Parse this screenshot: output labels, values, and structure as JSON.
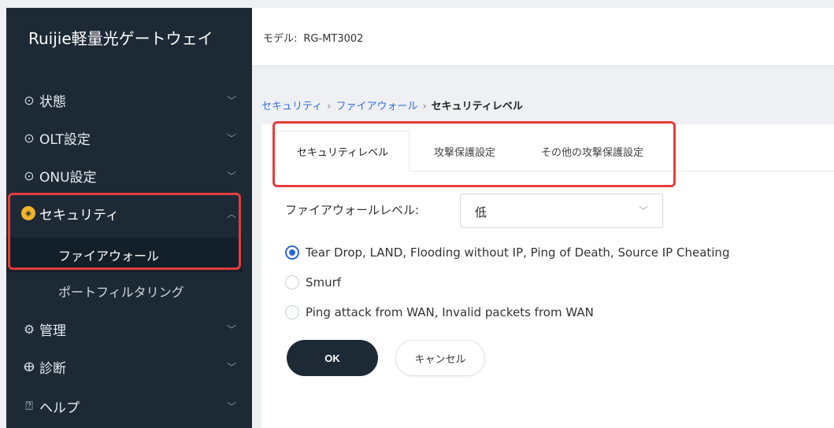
{
  "brand": "Ruijie軽量光ゲートウェイ",
  "model": {
    "label": "モデル:",
    "value": "RG-MT3002"
  },
  "sidebar": {
    "items": [
      {
        "label": "状態",
        "icon": "status-icon"
      },
      {
        "label": "OLT設定",
        "icon": "olt-icon"
      },
      {
        "label": "ONU設定",
        "icon": "onu-icon"
      },
      {
        "label": "セキュリティ",
        "icon": "shield-icon"
      },
      {
        "label": "管理",
        "icon": "gear-icon"
      },
      {
        "label": "診断",
        "icon": "stethoscope-icon"
      },
      {
        "label": "ヘルプ",
        "icon": "help-icon"
      }
    ],
    "sub_items": [
      {
        "label": "ファイアウォール"
      },
      {
        "label": "ポートフィルタリング"
      }
    ]
  },
  "breadcrumb": {
    "items": [
      "セキュリティ",
      "ファイアウォール"
    ],
    "current": "セキュリティレベル",
    "separator": "›"
  },
  "tabs": [
    {
      "label": "セキュリティレベル"
    },
    {
      "label": "攻撃保護設定"
    },
    {
      "label": "その他の攻撃保護設定"
    }
  ],
  "firewall": {
    "label": "ファイアウォールレベル:",
    "selected": "低",
    "options": [
      {
        "label": "Tear Drop, LAND, Flooding without IP, Ping of Death, Source IP Cheating",
        "checked": true
      },
      {
        "label": "Smurf",
        "checked": false
      },
      {
        "label": "Ping attack from WAN, Invalid packets from WAN",
        "checked": false
      }
    ]
  },
  "buttons": {
    "ok": "OK",
    "cancel": "キャンセル"
  },
  "colors": {
    "sidebar": "#1d2a36",
    "accent": "#2f64d6",
    "highlight": "#e63c3c",
    "shield": "#f0b429"
  }
}
